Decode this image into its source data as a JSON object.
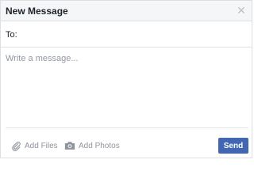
{
  "dialog": {
    "title": "New Message",
    "close_icon": "close-icon"
  },
  "to": {
    "label": "To:",
    "value": "",
    "placeholder": ""
  },
  "message": {
    "value": "",
    "placeholder": "Write a message..."
  },
  "actions": {
    "add_files": {
      "label": "Add Files",
      "icon": "paperclip-icon"
    },
    "add_photos": {
      "label": "Add Photos",
      "icon": "camera-icon"
    },
    "send_label": "Send"
  },
  "colors": {
    "accent": "#4267b2",
    "header_bg": "#f5f6f7",
    "muted_text": "#90949c",
    "border": "#dddfe2"
  }
}
